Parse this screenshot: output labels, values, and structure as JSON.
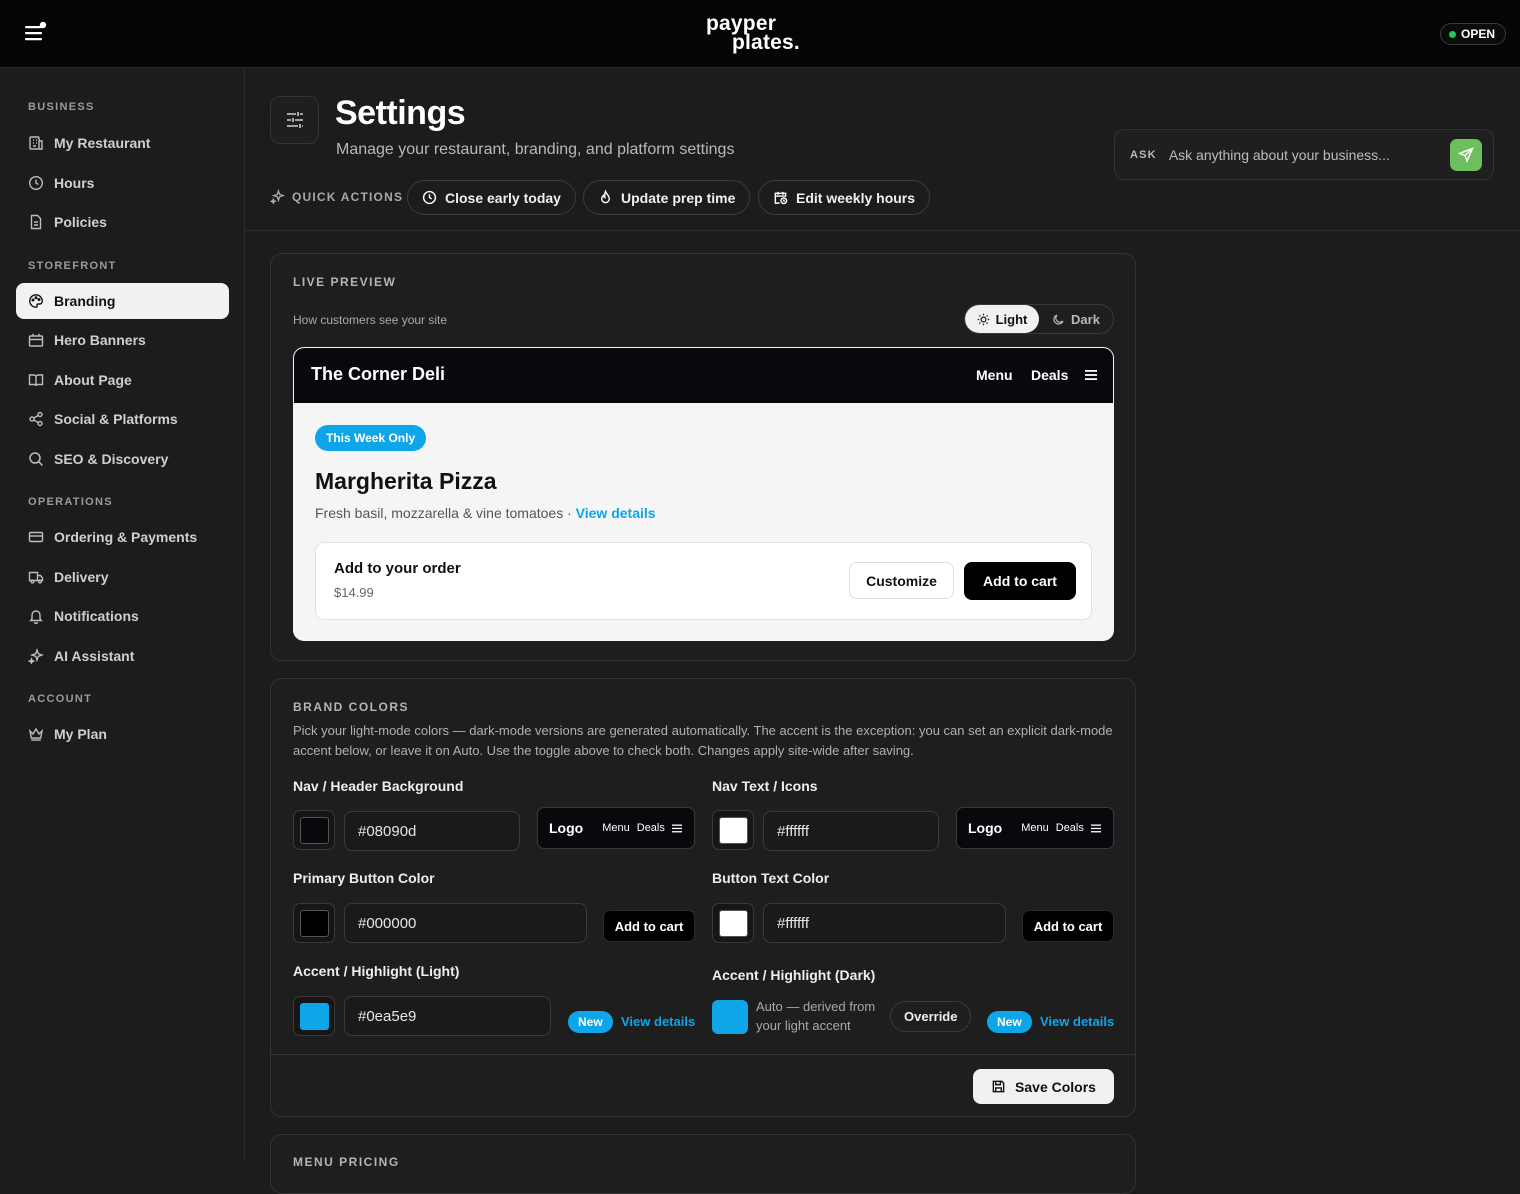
{
  "app": {
    "logo_line1": "payper",
    "logo_line2": "plates.",
    "status": "OPEN"
  },
  "sidebar": {
    "sections": [
      {
        "label": "BUSINESS"
      },
      {
        "label": "STOREFRONT"
      },
      {
        "label": "OPERATIONS"
      },
      {
        "label": "ACCOUNT"
      }
    ],
    "items": [
      {
        "label": "My Restaurant",
        "icon": "building-icon"
      },
      {
        "label": "Hours",
        "icon": "clock-icon"
      },
      {
        "label": "Policies",
        "icon": "document-icon"
      },
      {
        "label": "Branding",
        "icon": "palette-icon",
        "active": true
      },
      {
        "label": "Hero Banners",
        "icon": "banner-icon"
      },
      {
        "label": "About Page",
        "icon": "book-icon"
      },
      {
        "label": "Social & Platforms",
        "icon": "share-icon"
      },
      {
        "label": "SEO & Discovery",
        "icon": "search-icon"
      },
      {
        "label": "Ordering & Payments",
        "icon": "credit-card-icon"
      },
      {
        "label": "Delivery",
        "icon": "truck-icon"
      },
      {
        "label": "Notifications",
        "icon": "bell-icon"
      },
      {
        "label": "AI Assistant",
        "icon": "sparkles-icon"
      },
      {
        "label": "My Plan",
        "icon": "crown-icon"
      }
    ]
  },
  "header": {
    "title": "Settings",
    "subtitle": "Manage your restaurant, branding, and platform settings",
    "quick_actions_label": "QUICK ACTIONS",
    "quick_actions": [
      {
        "label": "Close early today"
      },
      {
        "label": "Update prep time"
      },
      {
        "label": "Edit weekly hours"
      }
    ],
    "ask_label": "ASK",
    "ask_placeholder": "Ask anything about your business..."
  },
  "live_preview": {
    "title": "LIVE PREVIEW",
    "caption": "How customers see your site",
    "mode_light": "Light",
    "mode_dark": "Dark",
    "selected_mode": "Light",
    "site": {
      "brand": "The Corner Deli",
      "nav_menu": "Menu",
      "nav_deals": "Deals",
      "badge": "This Week Only",
      "item_title": "Margherita Pizza",
      "item_desc": "Fresh basil, mozzarella & vine tomatoes · ",
      "item_link": "View details",
      "order_title": "Add to your order",
      "order_price": "$14.99",
      "customize_label": "Customize",
      "add_label": "Add to cart"
    }
  },
  "brand_colors": {
    "title": "BRAND COLORS",
    "description": "Pick your light-mode colors — dark-mode versions are generated automatically. The accent is the exception: you can set an explicit dark-mode accent below, or leave it on Auto. Use the toggle above to check both. Changes apply site-wide after saving.",
    "nav_bg": {
      "label": "Nav / Header Background",
      "value": "#08090d"
    },
    "nav_text": {
      "label": "Nav Text / Icons",
      "value": "#ffffff"
    },
    "primary_btn": {
      "label": "Primary Button Color",
      "value": "#000000"
    },
    "btn_text": {
      "label": "Button Text Color",
      "value": "#ffffff"
    },
    "accent_light": {
      "label": "Accent / Highlight (Light)",
      "value": "#0ea5e9"
    },
    "accent_dark": {
      "label": "Accent / Highlight (Dark)",
      "auto_text": "Auto — derived from your light accent",
      "override_label": "Override"
    },
    "mini_logo": "Logo",
    "mini_menu": "Menu",
    "mini_deals": "Deals",
    "mini_cart": "Add to cart",
    "new_label": "New",
    "view_details": "View details",
    "save_label": "Save Colors"
  },
  "next_card_title": "MENU PRICING"
}
